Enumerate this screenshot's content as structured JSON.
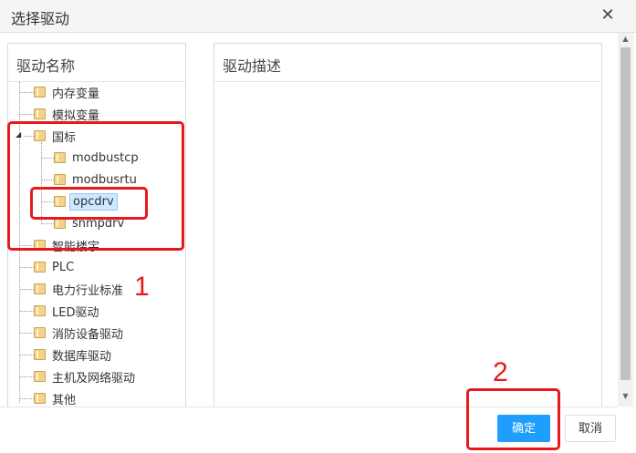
{
  "dialog": {
    "title": "选择驱动",
    "close_glyph": "✕",
    "ok_label": "确定",
    "cancel_label": "取消"
  },
  "left_panel": {
    "header": "驱动名称"
  },
  "right_panel": {
    "header": "驱动描述"
  },
  "tree": {
    "items": [
      {
        "label": "内存变量"
      },
      {
        "label": "模拟变量"
      },
      {
        "label": "国标",
        "expanded": true,
        "children": [
          {
            "label": "modbustcp"
          },
          {
            "label": "modbusrtu"
          },
          {
            "label": "opcdrv",
            "selected": true
          },
          {
            "label": "snmpdrv"
          }
        ]
      },
      {
        "label": "智能楼宇"
      },
      {
        "label": "PLC"
      },
      {
        "label": "电力行业标准"
      },
      {
        "label": "LED驱动"
      },
      {
        "label": "消防设备驱动"
      },
      {
        "label": "数据库驱动"
      },
      {
        "label": "主机及网络驱动"
      },
      {
        "label": "其他"
      }
    ]
  },
  "annotations": {
    "step1": "1",
    "step2": "2"
  },
  "colors": {
    "primary_button": "#1e9fff",
    "annotation": "#e8191c",
    "selection": "#cde8ff"
  }
}
